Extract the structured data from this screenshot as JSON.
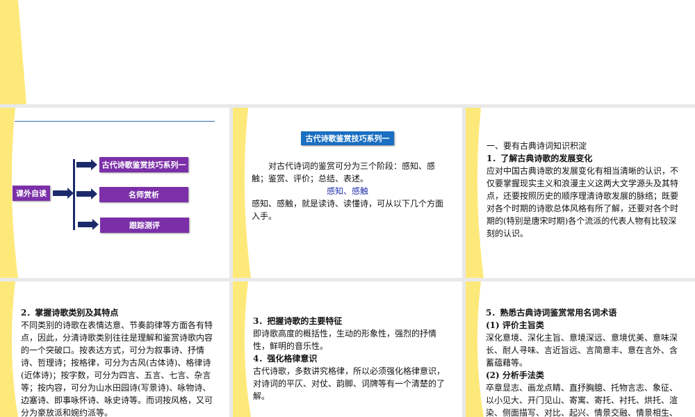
{
  "slides": {
    "s1": {
      "root": "课外自读",
      "branches": [
        "古代诗歌鉴赏技巧系列一",
        "名师赏析",
        "跟踪测评"
      ]
    },
    "s2": {
      "title": "古代诗歌鉴赏技巧系列一",
      "para1": "对古代诗词的鉴赏可分为三个阶段：感知、感触；鉴赏、评价；总结、表述。",
      "subheading": "感知、感触",
      "para2": "感知、感触，就是读诗、读懂诗，可从以下几个方面入手。"
    },
    "s3": {
      "heading": "一、要有古典诗词知识积淀",
      "sub": "1．了解古典诗歌的发展变化",
      "body": "应对中国古典诗歌的发展变化有相当清晰的认识，不仅要掌握现实主义和浪漫主义这两大文学源头及其特点，还要按照历史的顺序理清诗歌发展的脉络；既要对各个时期的诗歌总体风格有所了解，还要对各个时期的(特别是唐宋时期)各个流派的代表人物有比较深刻的认识。"
    },
    "s4": {
      "sub": "2．掌握诗歌类别及其特点",
      "body": "不同类别的诗歌在表情达意、节奏韵律等方面各有特点，因此，分清诗歌类别往往是理解和鉴赏诗歌内容的一个突破口。按表达方式，可分为叙事诗、抒情诗、哲理诗；按格律，可分为古风(古体诗)、格律诗(近体诗)；按字数，可分为四言、五言、七言、杂言等；按内容，可分为山水田园诗(写景诗)、咏物诗、边塞诗、即事咏怀诗、咏史诗等。而词按风格，又可分为豪放派和婉约派等。"
    },
    "s5": {
      "sub3": "3．把握诗歌的主要特征",
      "body3": "即诗歌高度的概括性，生动的形象性，强烈的抒情性，鲜明的音乐性。",
      "sub4": "4．强化格律意识",
      "body4": "古代诗歌，多数讲究格律，所以必须强化格律意识，对诗词的平仄、对仗、韵脚、词牌等有一个清楚的了解。"
    },
    "s6": {
      "sub": "5．熟悉古典诗词鉴赏常用名词术语",
      "cat1": "(1) 评价主旨类",
      "body1": "深化意境、深化主旨、意境深远、意境优美、意味深长、耐人寻味、言近旨远、言简意丰、意在言外、含蓄蕴藉等。",
      "cat2": "(2) 分析手法类",
      "body2": "卒章显志、画龙点睛、直抒胸臆、托物言志、象征、以小见大、开门见山、寄寓、寄托、衬托、烘托、渲染、侧面描写、对比、起兴、情景交融、情景相生、情因景生、借景抒情、以景衬情、融"
    }
  },
  "colors": {
    "wedge": "#fde97a",
    "purple": "#7b2fa8",
    "navy": "#1b2a6b",
    "blue_title": "#1a6fc2",
    "subheading": "#2233aa"
  }
}
